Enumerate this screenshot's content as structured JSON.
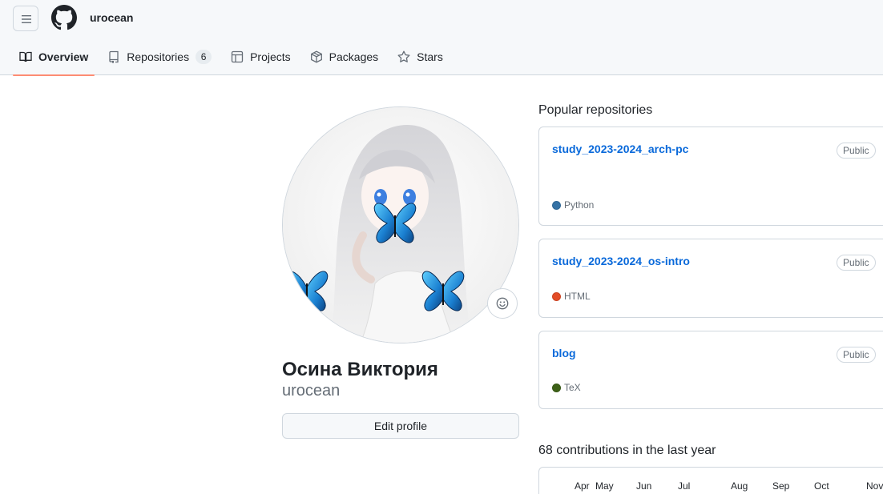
{
  "header": {
    "username": "urocean",
    "menu_icon": "hamburger-icon",
    "logo_icon": "github-logo-icon"
  },
  "tabs": [
    {
      "label": "Overview",
      "icon": "book-icon",
      "active": true
    },
    {
      "label": "Repositories",
      "icon": "repo-icon",
      "count": "6"
    },
    {
      "label": "Projects",
      "icon": "table-icon"
    },
    {
      "label": "Packages",
      "icon": "package-icon"
    },
    {
      "label": "Stars",
      "icon": "star-icon"
    }
  ],
  "profile": {
    "full_name": "Осина Виктория",
    "login": "urocean",
    "edit_button": "Edit profile",
    "status_icon": "smiley-icon"
  },
  "popular": {
    "title": "Popular repositories",
    "repos": [
      {
        "name": "study_2023-2024_arch-pc",
        "visibility": "Public",
        "language": "Python",
        "lang_color": "#3572A5"
      },
      {
        "name": "study_2023-2024_os-intro",
        "visibility": "Public",
        "language": "HTML",
        "lang_color": "#e34c26"
      },
      {
        "name": "blog",
        "visibility": "Public",
        "language": "TeX",
        "lang_color": "#3D6117"
      }
    ]
  },
  "contributions": {
    "title": "68 contributions in the last year",
    "months": [
      "Apr",
      "May",
      "Jun",
      "Jul",
      "Aug",
      "Sep",
      "Oct",
      "Nov"
    ]
  },
  "colors": {
    "accent_link": "#0969da",
    "tab_underline": "#fd8c73"
  }
}
